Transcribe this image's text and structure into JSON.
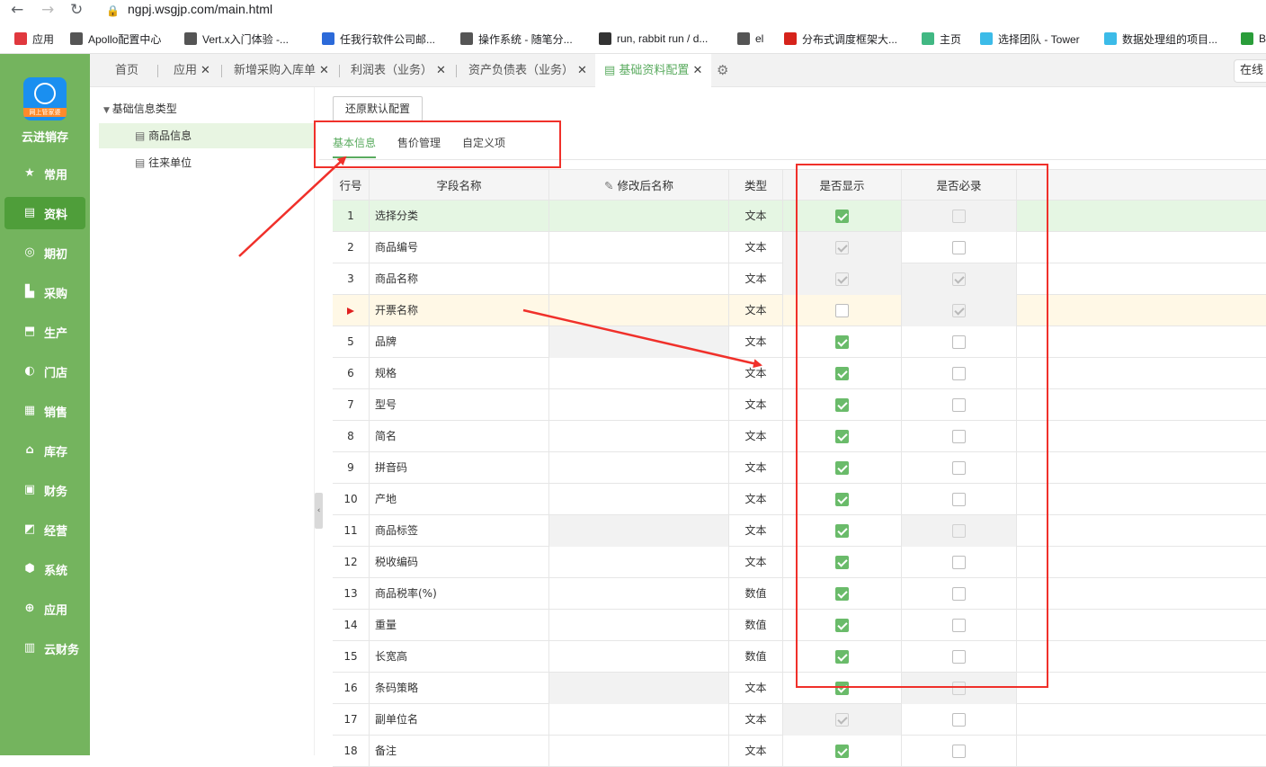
{
  "browser": {
    "url": "ngpj.wsgjp.com/main.html",
    "bookmarks": [
      {
        "label": "应用",
        "icon": "apps-grid-icon",
        "color": "#e0383e"
      },
      {
        "label": "Apollo配置中心",
        "icon": "apollo-icon",
        "color": "#555555"
      },
      {
        "label": "Vert.x入门体验 -...",
        "icon": "vertx-icon",
        "color": "#555555"
      },
      {
        "label": "任我行软件公司邮...",
        "icon": "mail-icon",
        "color": "#2c6ad9"
      },
      {
        "label": "操作系统 - 随笔分...",
        "icon": "vertx-icon",
        "color": "#555555"
      },
      {
        "label": "run, rabbit run / d...",
        "icon": "github-icon",
        "color": "#333333"
      },
      {
        "label": "el",
        "icon": "vertx-icon",
        "color": "#555555"
      },
      {
        "label": "分布式调度框架大...",
        "icon": "csdn-icon",
        "color": "#d6231b"
      },
      {
        "label": "主页",
        "icon": "vue-icon",
        "color": "#41b883"
      },
      {
        "label": "选择团队 - Tower",
        "icon": "tower-icon",
        "color": "#3cbbe8"
      },
      {
        "label": "数据处理组的项目...",
        "icon": "project-icon",
        "color": "#3cbbe8"
      },
      {
        "label": "B",
        "icon": "tr-icon",
        "color": "#2a9d3a"
      }
    ]
  },
  "sidebar": {
    "app_name": "云进销存",
    "logo_band": "网上管家婆",
    "items": [
      {
        "label": "常用",
        "icon": "star-icon"
      },
      {
        "label": "资料",
        "icon": "document-icon",
        "active": true
      },
      {
        "label": "期初",
        "icon": "target-icon"
      },
      {
        "label": "采购",
        "icon": "purchase-icon"
      },
      {
        "label": "生产",
        "icon": "production-icon"
      },
      {
        "label": "门店",
        "icon": "store-icon"
      },
      {
        "label": "销售",
        "icon": "sales-icon"
      },
      {
        "label": "库存",
        "icon": "warehouse-icon"
      },
      {
        "label": "财务",
        "icon": "finance-icon"
      },
      {
        "label": "经营",
        "icon": "business-icon"
      },
      {
        "label": "系统",
        "icon": "system-icon"
      },
      {
        "label": "应用",
        "icon": "app-plus-icon"
      },
      {
        "label": "云财务",
        "icon": "cloud-finance-icon"
      }
    ]
  },
  "tabs": {
    "items": [
      "首页",
      "应用",
      "新增采购入库单",
      "利润表（业务）",
      "资产负债表（业务）",
      "基础资料配置"
    ],
    "active": "基础资料配置",
    "right_cut_label": "在线"
  },
  "tree": {
    "root": "基础信息类型",
    "children": [
      "商品信息",
      "往来单位"
    ],
    "selected": "商品信息"
  },
  "toolbar": {
    "restore_label": "还原默认配置"
  },
  "subtabs": {
    "items": [
      "基本信息",
      "售价管理",
      "自定义项"
    ],
    "active": "基本信息"
  },
  "grid": {
    "headers": {
      "row_no": "行号",
      "field_name": "字段名称",
      "renamed": "修改后名称",
      "type": "类型",
      "show": "是否显示",
      "required": "是否必录"
    },
    "rows": [
      {
        "no": "1",
        "name": "选择分类",
        "type": "文本",
        "show": "on",
        "required": "dis",
        "state": "selected"
      },
      {
        "no": "2",
        "name": "商品编号",
        "type": "文本",
        "show": "dison",
        "required": "off"
      },
      {
        "no": "3",
        "name": "商品名称",
        "type": "文本",
        "show": "dison",
        "required": "dison"
      },
      {
        "no": "",
        "name": "开票名称",
        "type": "文本",
        "show": "off",
        "required": "dison",
        "state": "current"
      },
      {
        "no": "5",
        "name": "品牌",
        "type": "文本",
        "show": "on",
        "required": "off",
        "renamed_gray": true
      },
      {
        "no": "6",
        "name": "规格",
        "type": "文本",
        "show": "on",
        "required": "off"
      },
      {
        "no": "7",
        "name": "型号",
        "type": "文本",
        "show": "on",
        "required": "off"
      },
      {
        "no": "8",
        "name": "简名",
        "type": "文本",
        "show": "on",
        "required": "off"
      },
      {
        "no": "9",
        "name": "拼音码",
        "type": "文本",
        "show": "on",
        "required": "off"
      },
      {
        "no": "10",
        "name": "产地",
        "type": "文本",
        "show": "on",
        "required": "off"
      },
      {
        "no": "11",
        "name": "商品标签",
        "type": "文本",
        "show": "on",
        "required": "dis",
        "renamed_gray": true
      },
      {
        "no": "12",
        "name": "税收编码",
        "type": "文本",
        "show": "on",
        "required": "off"
      },
      {
        "no": "13",
        "name": "商品税率(%)",
        "type": "数值",
        "show": "on",
        "required": "off"
      },
      {
        "no": "14",
        "name": "重量",
        "type": "数值",
        "show": "on",
        "required": "off"
      },
      {
        "no": "15",
        "name": "长宽高",
        "type": "数值",
        "show": "on",
        "required": "off"
      },
      {
        "no": "16",
        "name": "条码策略",
        "type": "文本",
        "show": "on",
        "required": "dis",
        "renamed_gray": true
      },
      {
        "no": "17",
        "name": "副单位名",
        "type": "文本",
        "show": "dison",
        "required": "off"
      },
      {
        "no": "18",
        "name": "备注",
        "type": "文本",
        "show": "on",
        "required": "off"
      }
    ]
  },
  "colors": {
    "sidebar_bg": "#74b45e",
    "sidebar_active": "#4f9e3a",
    "accent": "#5aab5f",
    "annotation_red": "#f0302a"
  }
}
